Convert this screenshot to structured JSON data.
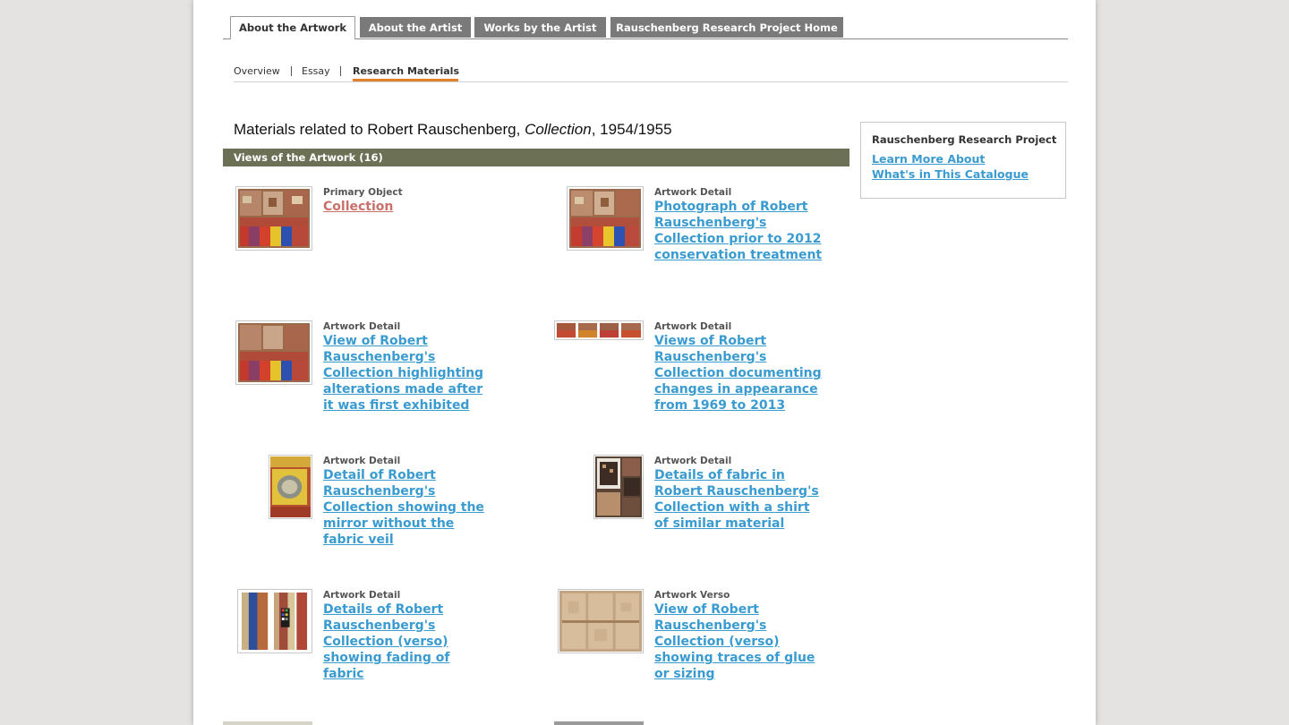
{
  "tabs": [
    {
      "label": "About the Artwork",
      "active": true
    },
    {
      "label": "About the Artist",
      "active": false
    },
    {
      "label": "Works by the Artist",
      "active": false
    },
    {
      "label": "Rauschenberg Research Project Home",
      "active": false
    }
  ],
  "subnav": [
    {
      "label": "Overview"
    },
    {
      "label": "Essay"
    },
    {
      "label": "Research Materials",
      "active": true
    }
  ],
  "heading": {
    "prefix": "Materials related to Robert Rauschenberg, ",
    "work": "Collection",
    "suffix": ", 1954/1955"
  },
  "section_bar": "Views of the Artwork (16)",
  "items": [
    {
      "type": "Primary Object",
      "title": "Collection",
      "thumb": "collection-thumbnail"
    },
    {
      "type": "Artwork Detail",
      "title": "Photograph of Robert Rauschenberg's Collection prior to 2012 conservation treatment",
      "thumb": "collection-photo-thumbnail"
    },
    {
      "type": "Artwork Detail",
      "title": "View of Robert Rauschenberg's Collection highlighting alterations made after it was first exhibited",
      "thumb": "collection-alterations-thumbnail"
    },
    {
      "type": "Artwork Detail",
      "title": "Views of Robert Rauschenberg's Collection documenting changes in appearance from 1969 to 2013",
      "thumb": "collection-sequence-thumbnail"
    },
    {
      "type": "Artwork Detail",
      "title": "Detail of Robert Rauschenberg's Collection showing the mirror without the fabric veil",
      "thumb": "mirror-detail-thumbnail"
    },
    {
      "type": "Artwork Detail",
      "title": "Details of fabric in Robert Rauschenberg's Collection with a shirt of similar material",
      "thumb": "fabric-shirt-thumbnail"
    },
    {
      "type": "Artwork Detail",
      "title": "Details of Robert Rauschenberg's Collection (verso) showing fading of fabric",
      "thumb": "verso-fabric-thumbnail"
    },
    {
      "type": "Artwork Verso",
      "title": "View of Robert Rauschenberg's Collection (verso) showing traces of glue or sizing",
      "thumb": "verso-panels-thumbnail"
    }
  ],
  "sidebar": {
    "title": "Rauschenberg Research Project",
    "links": [
      "Learn More About",
      "What's in This Catalogue"
    ]
  },
  "colors": {
    "link": "#3a9bd0",
    "primary_link": "#c9706a",
    "section_bar": "#6c7155",
    "active_underline": "#e3802a",
    "inactive_tab": "#7a7a7a"
  }
}
